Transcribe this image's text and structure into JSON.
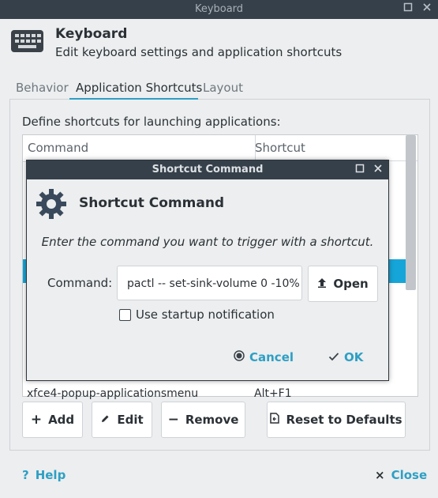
{
  "window": {
    "title": "Keyboard",
    "maximize_icon": "maximize-icon",
    "close_icon": "close-icon"
  },
  "header": {
    "icon": "keyboard-icon",
    "title": "Keyboard",
    "subtitle": "Edit keyboard settings and application shortcuts"
  },
  "tabs": [
    {
      "label": "Behavior",
      "active": false
    },
    {
      "label": "Application Shortcuts",
      "active": true
    },
    {
      "label": "Layout",
      "active": false
    }
  ],
  "shortcuts": {
    "description": "Define shortcuts for launching applications:",
    "columns": [
      "Command",
      "Shortcut"
    ],
    "visible_row": {
      "command": "xfce4-popup-applicationsmenu",
      "shortcut": "Alt+F1"
    }
  },
  "actions": {
    "add": "Add",
    "edit": "Edit",
    "remove": "Remove",
    "reset": "Reset to Defaults"
  },
  "footer": {
    "help": "Help",
    "close": "Close"
  },
  "dialog": {
    "title": "Shortcut Command",
    "icon": "gear-icon",
    "heading": "Shortcut Command",
    "instruction": "Enter the command you want to trigger with a shortcut.",
    "command_label": "Command:",
    "command_value": "pactl -- set-sink-volume 0 -10%",
    "open_label": "Open",
    "checkbox_label": "Use startup notification",
    "checkbox_checked": false,
    "cancel_label": "Cancel",
    "ok_label": "OK"
  },
  "colors": {
    "accent": "#2e9fc4",
    "selection": "#16a5d8",
    "titlebar": "#36404a"
  }
}
